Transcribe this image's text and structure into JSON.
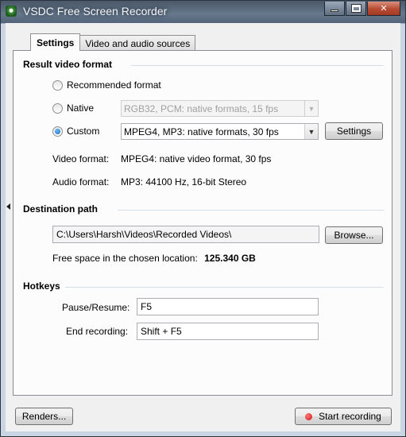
{
  "window": {
    "title": "VSDC Free Screen Recorder"
  },
  "tabs": [
    {
      "label": "Settings"
    },
    {
      "label": "Video and audio sources"
    }
  ],
  "result_video_format": {
    "title": "Result video format",
    "options": [
      {
        "label": "Recommended format",
        "selected": false
      },
      {
        "label": "Native",
        "selected": false,
        "combo_value": "RGB32, PCM: native formats, 15 fps",
        "enabled": false
      },
      {
        "label": "Custom",
        "selected": true,
        "combo_value": "MPEG4, MP3: native formats, 30 fps",
        "enabled": true
      }
    ],
    "settings_button": "Settings",
    "video_format_label": "Video format:",
    "video_format_value": "MPEG4: native video format, 30 fps",
    "audio_format_label": "Audio format:",
    "audio_format_value": "MP3: 44100 Hz, 16-bit Stereo"
  },
  "destination": {
    "title": "Destination path",
    "path": "C:\\Users\\Harsh\\Videos\\Recorded Videos\\",
    "browse_button": "Browse...",
    "free_space_label": "Free space in the chosen location:",
    "free_space_value": "125.340 GB"
  },
  "hotkeys": {
    "title": "Hotkeys",
    "pause_label": "Pause/Resume:",
    "pause_value": "F5",
    "end_label": "End recording:",
    "end_value": "Shift + F5"
  },
  "footer": {
    "renders_button": "Renders...",
    "start_button": "Start recording"
  },
  "colors": {
    "record_dot": "#d11010",
    "selected_radio": "#1a6fc2"
  }
}
